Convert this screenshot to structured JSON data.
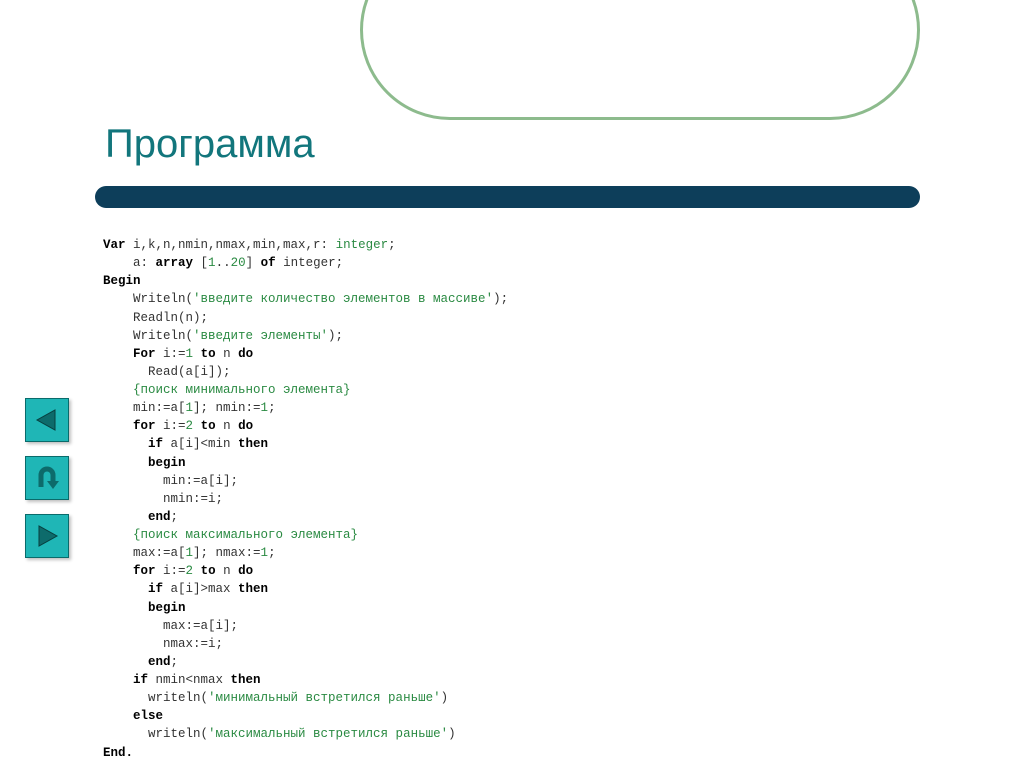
{
  "title": "Программа",
  "code": {
    "l1_var": "Var",
    "l1_rest": " i,k,n,nmin,nmax,min,max,r: ",
    "l1_type": "integer",
    "l1_end": ";",
    "l2_a": "    a: ",
    "l2_arr": "array",
    "l2_b": " [",
    "l2_n1": "1",
    "l2_dots": "..",
    "l2_n2": "20",
    "l2_c": "] ",
    "l2_of": "of",
    "l2_d": " integer;",
    "l3": "Begin",
    "l4_a": "    Writeln(",
    "l4_s": "'введите количество элементов в массиве'",
    "l4_b": ");",
    "l5": "    Readln(n);",
    "l6_a": "    Writeln(",
    "l6_s": "'введите элементы'",
    "l6_b": ");",
    "l7_a": "    ",
    "l7_for": "For",
    "l7_b": " i:=",
    "l7_n": "1",
    "l7_c": " ",
    "l7_to": "to",
    "l7_d": " n ",
    "l7_do": "do",
    "l8": "      Read(a[i]);",
    "l9": "    {поиск минимального элемента}",
    "l10_a": "    min:=a[",
    "l10_n1": "1",
    "l10_b": "]; nmin:=",
    "l10_n2": "1",
    "l10_c": ";",
    "l11_a": "    ",
    "l11_for": "for",
    "l11_b": " i:=",
    "l11_n": "2",
    "l11_c": " ",
    "l11_to": "to",
    "l11_d": " n ",
    "l11_do": "do",
    "l12_a": "      ",
    "l12_if": "if",
    "l12_b": " a[i]<min ",
    "l12_then": "then",
    "l13_a": "      ",
    "l13_begin": "begin",
    "l14": "        min:=a[i];",
    "l15": "        nmin:=i;",
    "l16_a": "      ",
    "l16_end": "end",
    "l16_b": ";",
    "l17": "    {поиск максимального элемента}",
    "l18_a": "    max:=a[",
    "l18_n1": "1",
    "l18_b": "]; nmax:=",
    "l18_n2": "1",
    "l18_c": ";",
    "l19_a": "    ",
    "l19_for": "for",
    "l19_b": " i:=",
    "l19_n": "2",
    "l19_c": " ",
    "l19_to": "to",
    "l19_d": " n ",
    "l19_do": "do",
    "l20_a": "      ",
    "l20_if": "if",
    "l20_b": " a[i]>max ",
    "l20_then": "then",
    "l21_a": "      ",
    "l21_begin": "begin",
    "l22": "        max:=a[i];",
    "l23": "        nmax:=i;",
    "l24_a": "      ",
    "l24_end": "end",
    "l24_b": ";",
    "l25_a": "    ",
    "l25_if": "if",
    "l25_b": " nmin<nmax ",
    "l25_then": "then",
    "l26_a": "      writeln(",
    "l26_s": "'минимальный встретился раньше'",
    "l26_b": ")",
    "l27_a": "    ",
    "l27_else": "else",
    "l28_a": "      writeln(",
    "l28_s": "'максимальный встретился раньше'",
    "l28_b": ")",
    "l29": "End."
  }
}
